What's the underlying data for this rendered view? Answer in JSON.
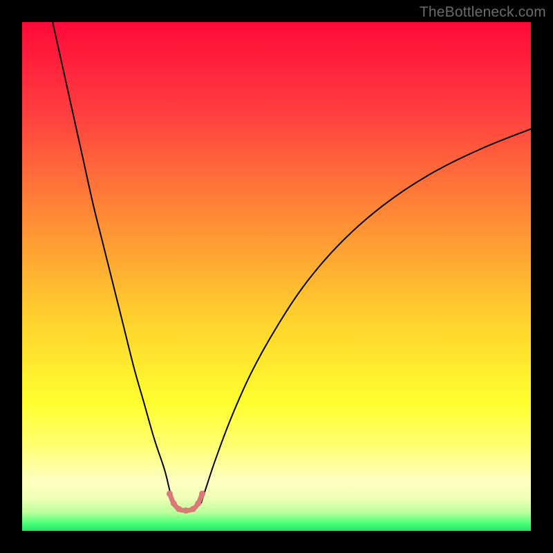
{
  "watermark": "TheBottleneck.com",
  "chart_data": {
    "type": "line",
    "title": "",
    "xlabel": "",
    "ylabel": "",
    "x_range": [
      0,
      100
    ],
    "y_range": [
      0,
      100
    ],
    "gradient_stops": [
      {
        "offset": 0.0,
        "color": "#ff0a3a"
      },
      {
        "offset": 0.18,
        "color": "#ff3f3f"
      },
      {
        "offset": 0.38,
        "color": "#ff8a36"
      },
      {
        "offset": 0.58,
        "color": "#ffd02e"
      },
      {
        "offset": 0.75,
        "color": "#ffff30"
      },
      {
        "offset": 0.83,
        "color": "#ffff70"
      },
      {
        "offset": 0.9,
        "color": "#ffffc0"
      },
      {
        "offset": 0.935,
        "color": "#f2ffb8"
      },
      {
        "offset": 0.965,
        "color": "#b8ff9a"
      },
      {
        "offset": 0.985,
        "color": "#4aff7a"
      },
      {
        "offset": 1.0,
        "color": "#28e268"
      }
    ],
    "series": [
      {
        "name": "left-branch",
        "x": [
          6,
          8,
          10,
          12,
          14,
          16,
          18,
          20,
          22,
          24,
          26,
          28,
          29,
          29.8
        ],
        "y": [
          100,
          91,
          82,
          73,
          64,
          56,
          48,
          40,
          32,
          25,
          18,
          12,
          8,
          5.5
        ]
      },
      {
        "name": "right-branch",
        "x": [
          35.2,
          36,
          38,
          41,
          45,
          50,
          56,
          63,
          71,
          80,
          90,
          100
        ],
        "y": [
          5.5,
          8,
          14,
          22,
          31,
          40,
          49,
          57,
          64,
          70,
          75,
          79
        ]
      }
    ],
    "trough_markers": {
      "color": "#d87a78",
      "stroke_width": 7,
      "dot_radius": 4.5,
      "points": [
        {
          "x": 29.0,
          "y": 7.3
        },
        {
          "x": 29.8,
          "y": 5.4
        },
        {
          "x": 30.8,
          "y": 4.3
        },
        {
          "x": 32.2,
          "y": 4.0
        },
        {
          "x": 33.6,
          "y": 4.3
        },
        {
          "x": 34.6,
          "y": 5.4
        },
        {
          "x": 35.4,
          "y": 7.3
        }
      ]
    }
  }
}
